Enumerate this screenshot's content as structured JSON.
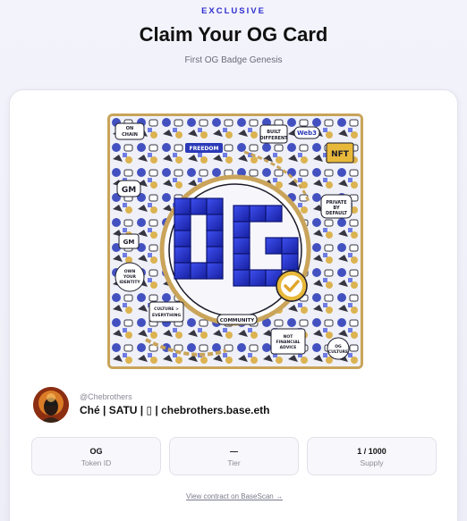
{
  "header": {
    "kicker": "EXCLUSIVE",
    "title": "Claim Your OG Card",
    "subtitle": "First OG Badge Genesis"
  },
  "artwork": {
    "monogram": "OG",
    "stickers": [
      "ON CHAIN",
      "FREEDOM",
      "BUILT DIFFERENT",
      "Web3",
      "NFT",
      "GM",
      "PRIVATE BY DEFAULT",
      "OWN YOUR IDENTITY",
      "CULTURE > EVERYTHING",
      "COMMUNITY",
      "NOT FINANCIAL ADVICE",
      "OG CULTURE"
    ],
    "colors": {
      "accent": "#2233c8",
      "frame": "#c9a45a",
      "check": "#e7b83a"
    }
  },
  "owner": {
    "handle": "@Chebrothers",
    "display_name": "Ché | SATU | ▯ | chebrothers.base.eth"
  },
  "stats": [
    {
      "value": "OG",
      "label": "Token ID"
    },
    {
      "value": "—",
      "label": "Tier"
    },
    {
      "value": "1 / 1000",
      "label": "Supply"
    }
  ],
  "footer": {
    "contract_link": "View contract on BaseScan →"
  },
  "theme": {
    "accent": "#2f2fd0",
    "background": "#f3f3fb"
  }
}
